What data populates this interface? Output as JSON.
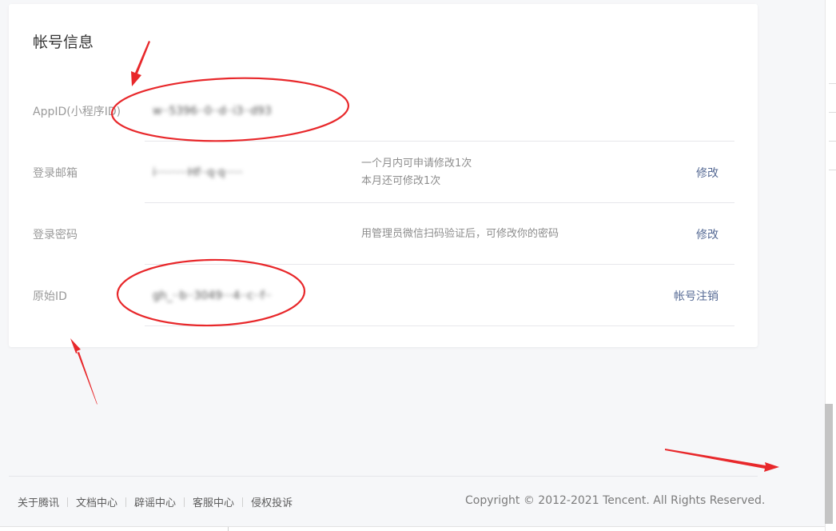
{
  "account_info": {
    "title": "帐号信息",
    "rows": [
      {
        "label": "AppID(小程序ID)",
        "value": "w··5396··0··d··i3··d93",
        "desc": [],
        "action": ""
      },
      {
        "label": "登录邮箱",
        "value": "i·········Hf··q·q·····",
        "desc": [
          "一个月内可申请修改1次",
          "本月还可修改1次"
        ],
        "action": "修改"
      },
      {
        "label": "登录密码",
        "value": "",
        "desc": [
          "用管理员微信扫码验证后，可修改你的密码"
        ],
        "action": "修改"
      },
      {
        "label": "原始ID",
        "value": "gh_··b··3049···4··c··f··",
        "desc": [],
        "action": "帐号注销"
      }
    ]
  },
  "footer": {
    "links": [
      "关于腾讯",
      "文档中心",
      "辟谣中心",
      "客服中心",
      "侵权投诉"
    ],
    "copyright": "Copyright © 2012-2021 Tencent. All Rights Reserved."
  },
  "colors": {
    "page_bg": "#f6f7f9",
    "link": "#576b95",
    "annotation_red": "#e8282b"
  }
}
